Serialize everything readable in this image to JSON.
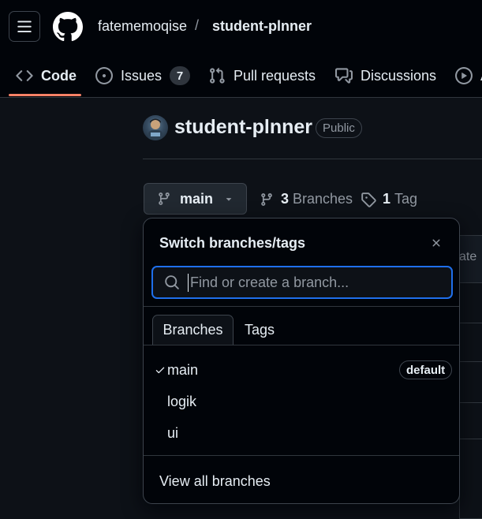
{
  "header": {
    "owner": "fatememoqise",
    "separator": "/",
    "repo": "student-plnner"
  },
  "nav_tabs": [
    {
      "label": "Code",
      "icon": "code-icon",
      "selected": true
    },
    {
      "label": "Issues",
      "icon": "issue-opened-icon",
      "count": "7"
    },
    {
      "label": "Pull requests",
      "icon": "git-pull-request-icon"
    },
    {
      "label": "Discussions",
      "icon": "comment-discussion-icon"
    },
    {
      "label": "A",
      "icon": "play-icon"
    }
  ],
  "repo": {
    "title": "student-plnner",
    "visibility": "Public"
  },
  "branch_bar": {
    "current_branch": "main",
    "branch_count": "3",
    "branches_label": "Branches",
    "tag_count": "1",
    "tags_label": "Tag"
  },
  "background": {
    "fragment_text": "ate"
  },
  "branch_menu": {
    "title": "Switch branches/tags",
    "search_placeholder": "Find or create a branch...",
    "tabs": [
      {
        "label": "Branches",
        "selected": true
      },
      {
        "label": "Tags",
        "selected": false
      }
    ],
    "branches": [
      {
        "name": "main",
        "checked": true,
        "badge": "default"
      },
      {
        "name": "logik",
        "checked": false
      },
      {
        "name": "ui",
        "checked": false
      }
    ],
    "view_all_label": "View all branches"
  },
  "colors": {
    "accent": "#1f6feb",
    "tab_underline": "#f78166",
    "header_bg": "#010409",
    "page_bg": "#0d1117"
  }
}
